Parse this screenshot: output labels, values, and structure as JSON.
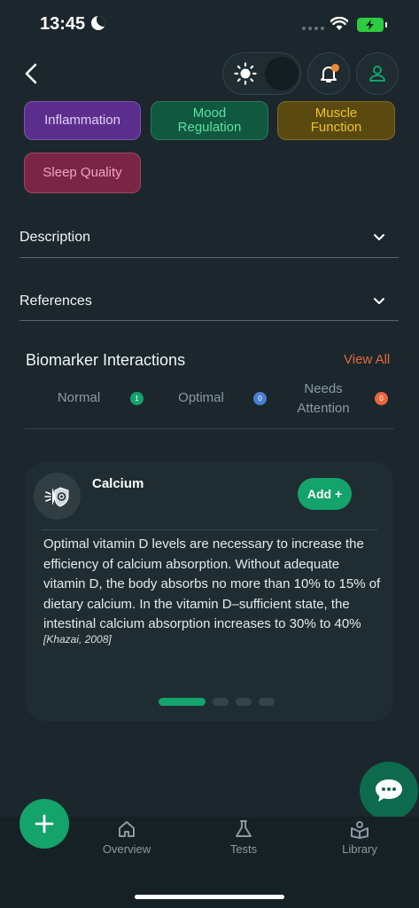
{
  "status_bar": {
    "time": "13:45"
  },
  "tags": [
    {
      "label": "Inflammation"
    },
    {
      "label": "Mood Regulation"
    },
    {
      "label": "Muscle Function"
    },
    {
      "label": "Sleep Quality"
    }
  ],
  "accordions": [
    {
      "label": "Description"
    },
    {
      "label": "References"
    }
  ],
  "interactions": {
    "title": "Biomarker Interactions",
    "view_all": "View All",
    "legend": [
      {
        "label": "Normal",
        "count": "1",
        "color": "#13a36b"
      },
      {
        "label": "Optimal",
        "count": "0",
        "color": "#4a7fd4"
      },
      {
        "label": "Needs Attention",
        "count": "0",
        "color": "#e8673b"
      }
    ]
  },
  "card": {
    "title": "Calcium",
    "add_label": "Add +",
    "body": "Optimal vitamin D levels are necessary to increase the efficiency of calcium absorption. Without adequate vitamin D, the body absorbs no more than 10% to 15% of dietary calcium. In the vitamin D–sufficient state, the intestinal calcium absorption increases to 30% to 40%",
    "citation": "[Khazai, 2008]",
    "pages": 4,
    "active_page": 1
  },
  "bottom_nav": [
    {
      "label": "Overview",
      "icon": "home-icon"
    },
    {
      "label": "Tests",
      "icon": "flask-icon"
    },
    {
      "label": "Library",
      "icon": "library-icon"
    }
  ],
  "colors": {
    "background": "#1b272c",
    "accent": "#13a36b",
    "warning": "#e8673b"
  }
}
